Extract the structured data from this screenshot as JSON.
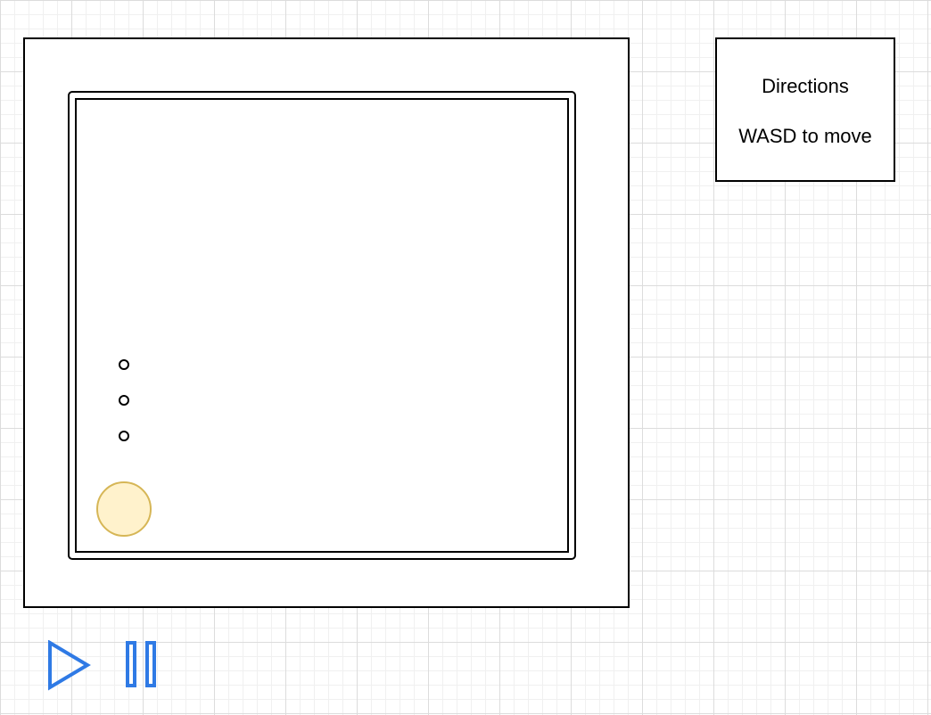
{
  "directions": {
    "title": "Directions",
    "instruction": "WASD to move"
  },
  "player": {
    "fill_color": "#fff2cc",
    "stroke_color": "#d6b656"
  },
  "controls": {
    "icon_color": "#2f7ae5",
    "play_icon": "play-icon",
    "pause_icon": "pause-icon"
  }
}
